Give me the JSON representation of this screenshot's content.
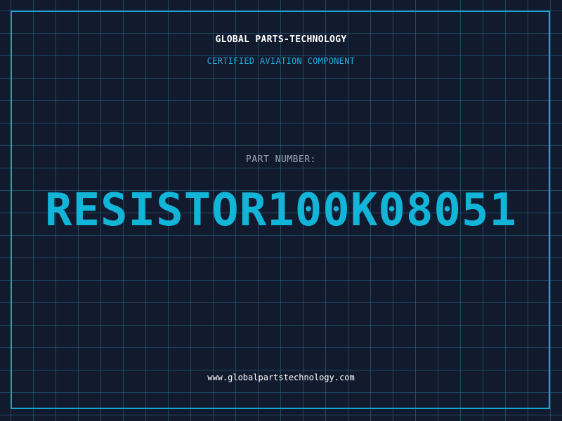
{
  "brand": {
    "name": "GLOBAL PARTS-TECHNOLOGY",
    "tagline": "CERTIFIED AVIATION COMPONENT"
  },
  "part": {
    "label": "PART NUMBER:",
    "number": "RESISTOR100K08051"
  },
  "footer": {
    "website": "www.globalpartstechnology.com"
  },
  "colors": {
    "background": "#121a2e",
    "grid": "#286e8c",
    "accent": "#12b4d8",
    "frame": "#1aa3cc",
    "label": "#9aa7b6",
    "text": "#ffffff"
  }
}
